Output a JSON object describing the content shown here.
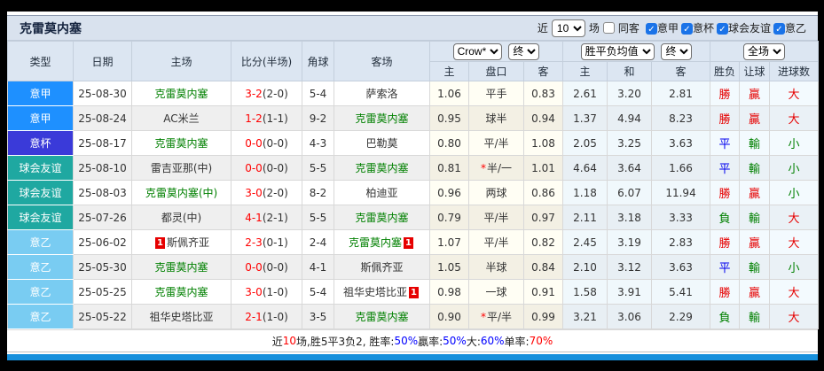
{
  "window": {
    "title": "克雷莫内塞",
    "toolbar": {
      "recent_label": "近",
      "matches_value": "10",
      "matches_label": "场",
      "same_away_label": "同客",
      "league_filters": [
        {
          "label": "意甲",
          "checked": true
        },
        {
          "label": "意杯",
          "checked": true
        },
        {
          "label": "球会友谊",
          "checked": true
        },
        {
          "label": "意乙",
          "checked": true
        }
      ]
    }
  },
  "table": {
    "headers": {
      "type": "类型",
      "date": "日期",
      "home": "主场",
      "score": "比分(半场)",
      "corner": "角球",
      "away": "客场",
      "crown_select": "Crow*",
      "crown_final_select": "终",
      "avg_select": "胜平负均值",
      "avg_final_select": "终",
      "scope_select": "全场",
      "crown_home": "主",
      "crown_handicap": "盘口",
      "crown_away": "客",
      "avg_home": "主",
      "avg_draw": "和",
      "avg_away": "客",
      "result_wdl": "胜负",
      "result_handicap": "让球",
      "result_goals": "进球数"
    },
    "rows": [
      {
        "league": "意甲",
        "league_color": "#1E90FF",
        "date": "25-08-30",
        "home": {
          "name": "克雷莫内塞",
          "green": true,
          "card": false
        },
        "score_full": "3-2",
        "score_half": "(2-0)",
        "corner": "5-4",
        "away": {
          "name": "萨索洛",
          "green": false,
          "card": false
        },
        "crown": [
          "1.06",
          "平手",
          "0.83"
        ],
        "handicap_star": false,
        "avg": [
          "2.61",
          "3.20",
          "2.81"
        ],
        "results": [
          [
            "勝",
            "red"
          ],
          [
            "贏",
            "red"
          ],
          [
            "大",
            "red"
          ]
        ]
      },
      {
        "league": "意甲",
        "league_color": "#1E90FF",
        "date": "25-08-24",
        "home": {
          "name": "AC米兰",
          "green": false,
          "card": false
        },
        "score_full": "1-2",
        "score_half": "(1-1)",
        "corner": "9-2",
        "away": {
          "name": "克雷莫内塞",
          "green": true,
          "card": false
        },
        "crown": [
          "0.95",
          "球半",
          "0.94"
        ],
        "handicap_star": false,
        "avg": [
          "1.37",
          "4.94",
          "8.23"
        ],
        "results": [
          [
            "勝",
            "red"
          ],
          [
            "贏",
            "red"
          ],
          [
            "大",
            "red"
          ]
        ]
      },
      {
        "league": "意杯",
        "league_color": "#3A3AD9",
        "date": "25-08-17",
        "home": {
          "name": "克雷莫内塞",
          "green": true,
          "card": false
        },
        "score_full": "0-0",
        "score_half": "(0-0)",
        "corner": "4-3",
        "away": {
          "name": "巴勒莫",
          "green": false,
          "card": false
        },
        "crown": [
          "0.80",
          "平/半",
          "1.08"
        ],
        "handicap_star": false,
        "avg": [
          "2.05",
          "3.25",
          "3.63"
        ],
        "results": [
          [
            "平",
            "blue"
          ],
          [
            "輸",
            "green"
          ],
          [
            "小",
            "green"
          ]
        ]
      },
      {
        "league": "球会友谊",
        "league_color": "#1FA8A1",
        "date": "25-08-10",
        "home": {
          "name": "雷吉亚那(中)",
          "green": false,
          "card": false
        },
        "score_full": "0-0",
        "score_half": "(0-0)",
        "corner": "5-5",
        "away": {
          "name": "克雷莫内塞",
          "green": true,
          "card": false
        },
        "crown": [
          "0.81",
          "半/一",
          "1.01"
        ],
        "handicap_star": true,
        "avg": [
          "4.64",
          "3.64",
          "1.66"
        ],
        "results": [
          [
            "平",
            "blue"
          ],
          [
            "輸",
            "green"
          ],
          [
            "小",
            "green"
          ]
        ]
      },
      {
        "league": "球会友谊",
        "league_color": "#1FA8A1",
        "date": "25-08-03",
        "home": {
          "name": "克雷莫内塞(中)",
          "green": true,
          "card": false
        },
        "score_full": "3-0",
        "score_half": "(2-0)",
        "corner": "8-2",
        "away": {
          "name": "柏迪亚",
          "green": false,
          "card": false
        },
        "crown": [
          "0.96",
          "两球",
          "0.86"
        ],
        "handicap_star": false,
        "avg": [
          "1.18",
          "6.07",
          "11.94"
        ],
        "results": [
          [
            "勝",
            "red"
          ],
          [
            "贏",
            "red"
          ],
          [
            "小",
            "green"
          ]
        ]
      },
      {
        "league": "球会友谊",
        "league_color": "#1FA8A1",
        "date": "25-07-26",
        "home": {
          "name": "都灵(中)",
          "green": false,
          "card": false
        },
        "score_full": "4-1",
        "score_half": "(2-1)",
        "corner": "5-5",
        "away": {
          "name": "克雷莫内塞",
          "green": true,
          "card": false
        },
        "crown": [
          "0.79",
          "平/半",
          "0.97"
        ],
        "handicap_star": false,
        "avg": [
          "2.11",
          "3.18",
          "3.33"
        ],
        "results": [
          [
            "負",
            "green"
          ],
          [
            "輸",
            "green"
          ],
          [
            "大",
            "red"
          ]
        ]
      },
      {
        "league": "意乙",
        "league_color": "#79CCF2",
        "date": "25-06-02",
        "home": {
          "name": "斯佩齐亚",
          "green": false,
          "card": true
        },
        "score_full": "2-3",
        "score_half": "(0-1)",
        "corner": "2-4",
        "away": {
          "name": "克雷莫内塞",
          "green": true,
          "card": true
        },
        "crown": [
          "1.07",
          "平/半",
          "0.82"
        ],
        "handicap_star": false,
        "avg": [
          "2.45",
          "3.19",
          "2.83"
        ],
        "results": [
          [
            "勝",
            "red"
          ],
          [
            "贏",
            "red"
          ],
          [
            "大",
            "red"
          ]
        ]
      },
      {
        "league": "意乙",
        "league_color": "#79CCF2",
        "date": "25-05-30",
        "home": {
          "name": "克雷莫内塞",
          "green": true,
          "card": false
        },
        "score_full": "0-0",
        "score_half": "(0-0)",
        "corner": "4-1",
        "away": {
          "name": "斯佩齐亚",
          "green": false,
          "card": false
        },
        "crown": [
          "1.05",
          "半球",
          "0.84"
        ],
        "handicap_star": false,
        "avg": [
          "2.10",
          "3.12",
          "3.63"
        ],
        "results": [
          [
            "平",
            "blue"
          ],
          [
            "輸",
            "green"
          ],
          [
            "小",
            "green"
          ]
        ]
      },
      {
        "league": "意乙",
        "league_color": "#79CCF2",
        "date": "25-05-25",
        "home": {
          "name": "克雷莫内塞",
          "green": true,
          "card": false
        },
        "score_full": "3-0",
        "score_half": "(1-0)",
        "corner": "5-4",
        "away": {
          "name": "祖华史塔比亚",
          "green": false,
          "card": true
        },
        "crown": [
          "0.98",
          "一球",
          "0.91"
        ],
        "handicap_star": false,
        "avg": [
          "1.58",
          "3.91",
          "5.41"
        ],
        "results": [
          [
            "勝",
            "red"
          ],
          [
            "贏",
            "red"
          ],
          [
            "大",
            "red"
          ]
        ]
      },
      {
        "league": "意乙",
        "league_color": "#79CCF2",
        "date": "25-05-22",
        "home": {
          "name": "祖华史塔比亚",
          "green": false,
          "card": false
        },
        "score_full": "2-1",
        "score_half": "(1-0)",
        "corner": "3-5",
        "away": {
          "name": "克雷莫内塞",
          "green": true,
          "card": false
        },
        "crown": [
          "0.90",
          "平/半",
          "0.99"
        ],
        "handicap_star": true,
        "avg": [
          "3.21",
          "3.06",
          "2.29"
        ],
        "results": [
          [
            "負",
            "green"
          ],
          [
            "輸",
            "green"
          ],
          [
            "大",
            "red"
          ]
        ]
      }
    ]
  },
  "summary": {
    "segments": [
      {
        "text": "近",
        "color": "black"
      },
      {
        "text": "10",
        "color": "red"
      },
      {
        "text": "场,胜5平3负2, 胜率:",
        "color": "black"
      },
      {
        "text": "50%",
        "color": "blue"
      },
      {
        "text": " 贏率:",
        "color": "black"
      },
      {
        "text": "50%",
        "color": "blue"
      },
      {
        "text": " 大:",
        "color": "black"
      },
      {
        "text": "60%",
        "color": "blue"
      },
      {
        "text": " 单率:",
        "color": "black"
      },
      {
        "text": "70%",
        "color": "red"
      }
    ]
  },
  "colors": {
    "serie_a_badge": "#1E90FF",
    "coppa_badge": "#3A3AD9",
    "friendly_badge": "#1FA8A1",
    "serie_b_badge": "#79CCF2",
    "win_red": "#E60000",
    "draw_blue": "#0000EE",
    "lose_green": "#008000",
    "team_green": "#008000",
    "score_red": "#FF0000",
    "checkbox_blue": "#1A73E8",
    "accent_bar": "#1790DC"
  }
}
